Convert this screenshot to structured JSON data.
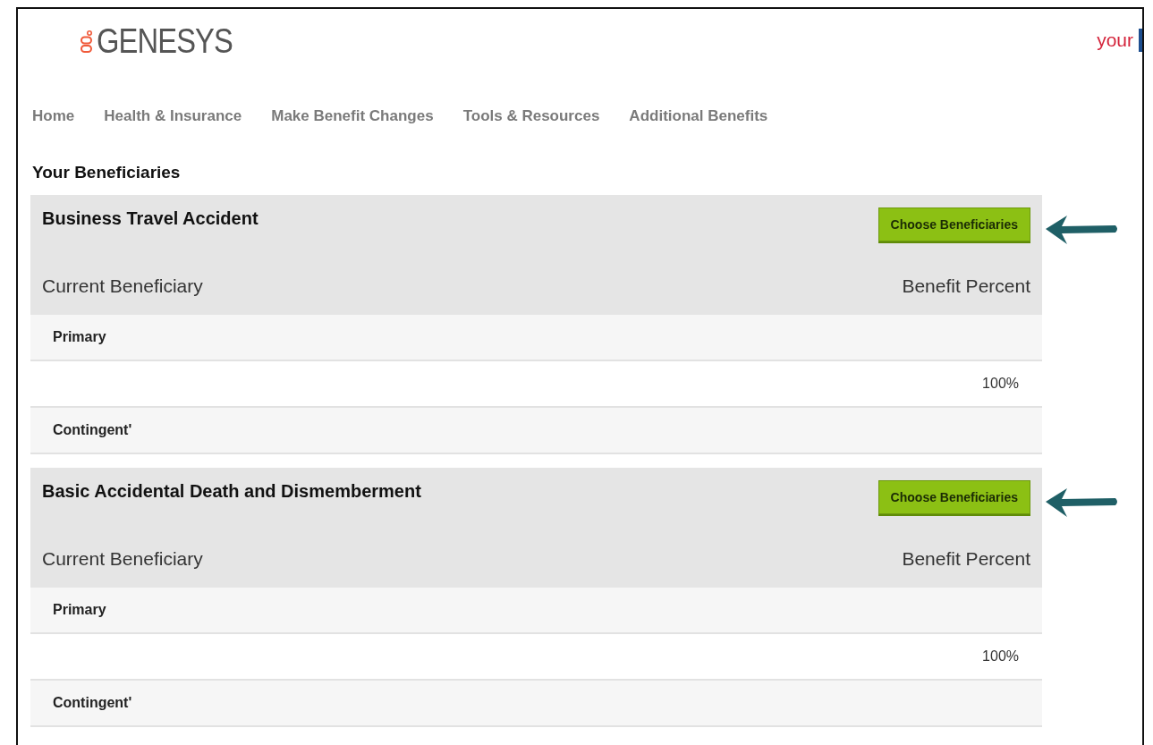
{
  "header": {
    "logo_text": "GENESYS",
    "corner_text": "your"
  },
  "nav": [
    {
      "label": "Home"
    },
    {
      "label": "Health & Insurance"
    },
    {
      "label": "Make Benefit Changes"
    },
    {
      "label": "Tools & Resources"
    },
    {
      "label": "Additional Benefits"
    }
  ],
  "page_title": "Your Beneficiaries",
  "plans": [
    {
      "name": "Business Travel Accident",
      "button": "Choose Beneficiaries",
      "col_left": "Current Beneficiary",
      "col_right": "Benefit Percent",
      "rows": [
        {
          "kind": "group",
          "label": "Primary"
        },
        {
          "kind": "value",
          "percent": "100%"
        },
        {
          "kind": "group",
          "label": "Contingent'"
        }
      ]
    },
    {
      "name": "Basic Accidental Death and Dismemberment",
      "button": "Choose Beneficiaries",
      "col_left": "Current Beneficiary",
      "col_right": "Benefit Percent",
      "rows": [
        {
          "kind": "group",
          "label": "Primary"
        },
        {
          "kind": "value",
          "percent": "100%"
        },
        {
          "kind": "group",
          "label": "Contingent'"
        }
      ]
    }
  ]
}
